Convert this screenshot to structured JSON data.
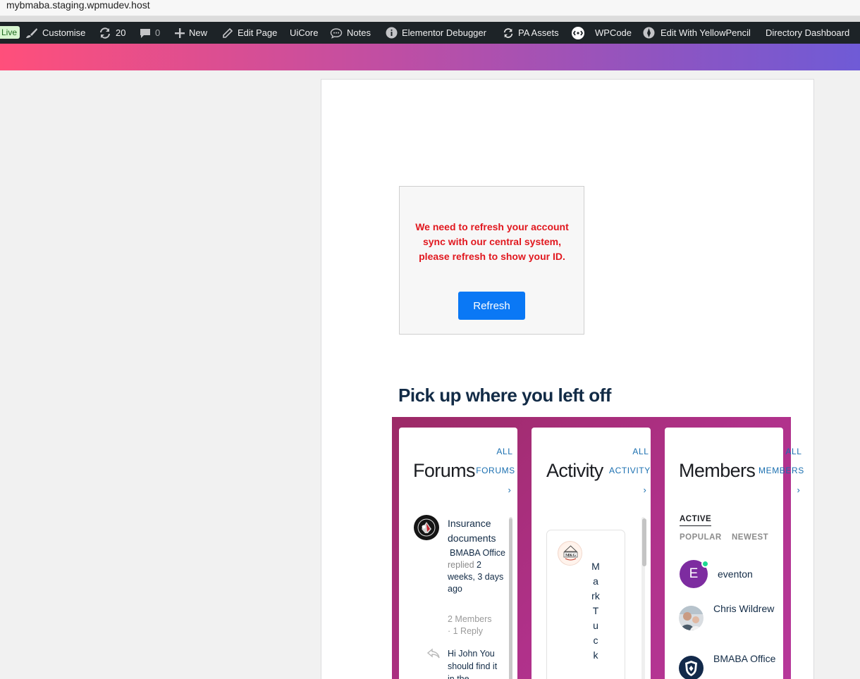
{
  "browser": {
    "url": "mybmaba.staging.wpmudev.host"
  },
  "admin_bar": {
    "live": "Live",
    "customise": "Customise",
    "updates_count": "20",
    "comments_count": "0",
    "new": "New",
    "edit_page": "Edit Page",
    "uicore": "UiCore",
    "notes": "Notes",
    "elementor_debugger": "Elementor Debugger",
    "pa_assets": "PA Assets",
    "wpcode": "WPCode",
    "yellowpencil": "Edit With YellowPencil",
    "directory_dashboard": "Directory Dashboard"
  },
  "notice": {
    "message": "We need to refresh your account sync with our central system, please refresh to show your ID.",
    "button": "Refresh"
  },
  "dashboard": {
    "section_title": "Pick up where you left off",
    "forums": {
      "title": "Forums",
      "all_word": "ALL",
      "link_word": "FORUMS",
      "chevron": "›",
      "topic_title": "Insurance documents",
      "author": "BMABA Office",
      "action": "replied",
      "time": "2 weeks, 3 days ago",
      "members": "2 Members",
      "replies": "· 1 Reply",
      "excerpt": "Hi John You should find it in the"
    },
    "activity": {
      "title": "Activity",
      "all_word": "ALL",
      "link_word": "ACTIVITY",
      "chevron": "›",
      "author_vertical": "MarkTuck"
    },
    "members": {
      "title": "Members",
      "all_word": "ALL",
      "link_word": "MEMBERS",
      "chevron": "›",
      "tabs": {
        "active": "ACTIVE",
        "popular": "POPULAR",
        "newest": "NEWEST"
      },
      "list": [
        {
          "initial": "E",
          "name": "eventon"
        },
        {
          "name": "Chris Wildrew"
        },
        {
          "name": "BMABA Office"
        }
      ]
    }
  },
  "colors": {
    "brand_red": "#e1181f",
    "button_blue": "#0a78f5",
    "title_navy": "#122b46",
    "online": "#1cd991"
  }
}
